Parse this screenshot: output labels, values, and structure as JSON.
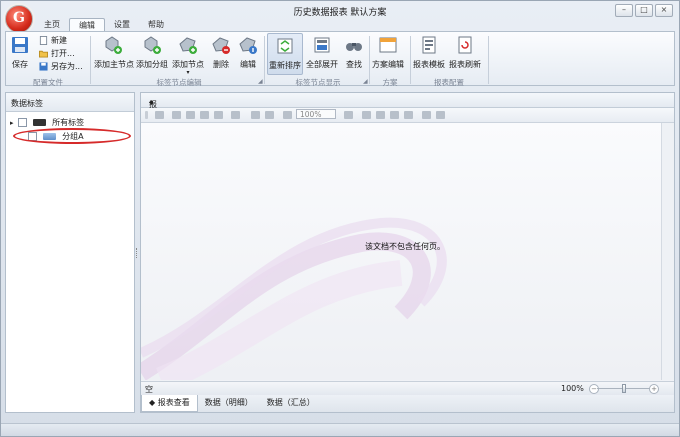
{
  "window": {
    "title": "历史数据报表 默认方案"
  },
  "app_icon": {
    "letter": "G"
  },
  "menu_tabs": [
    {
      "label": "主页"
    },
    {
      "label": "编辑"
    },
    {
      "label": "设置"
    },
    {
      "label": "帮助"
    }
  ],
  "active_tab": "编辑",
  "ribbon": {
    "config_file": {
      "save": "保存",
      "new": "新建",
      "open": "打开...",
      "save_as": "另存为...",
      "group_label": "配置文件"
    },
    "tag_edit": {
      "add_main_node": "添加主节点",
      "add_group": "添加分组",
      "add_node": "添加节点",
      "delete": "删除",
      "edit": "编辑",
      "group_label": "标签节点编辑"
    },
    "tag_display": {
      "resort": "重新排序",
      "expand_all": "全部展开",
      "find": "查找",
      "group_label": "标签节点显示"
    },
    "scheme": {
      "scheme_edit": "方案编辑",
      "group_label": "方案"
    },
    "report_config": {
      "report_template": "报表模板",
      "report_refresh": "报表刷新",
      "group_label": "报表配置"
    }
  },
  "left_panel": {
    "title": "数据标签",
    "collapse_glyph": "«",
    "tree": {
      "root_label": "所有标签",
      "child_label": "分组A",
      "expand_glyph": "▸"
    }
  },
  "right_panel": {
    "title": "报表查看",
    "bullet": "◆",
    "zoom_box": "100%",
    "empty_message": "该文档不包含任何页。",
    "status_left": "空",
    "zoom_level": "100%",
    "zoom_value": 0.5,
    "bottom_tabs": [
      {
        "label": "◆ 报表查看"
      },
      {
        "label": "数据（明细）"
      },
      {
        "label": "数据（汇总）"
      }
    ]
  },
  "colors": {
    "accent_green": "#3cad3c",
    "accent_red": "#d62a2a",
    "accent_blue": "#3a78c8"
  },
  "icons": [
    "save-icon",
    "new-file-icon",
    "open-folder-icon",
    "save-as-icon",
    "add-main-node-icon",
    "add-group-icon",
    "add-node-icon",
    "delete-icon",
    "edit-icon",
    "resort-icon",
    "expand-all-icon",
    "find-binoculars-icon",
    "scheme-edit-icon",
    "report-template-icon",
    "report-refresh-icon"
  ]
}
